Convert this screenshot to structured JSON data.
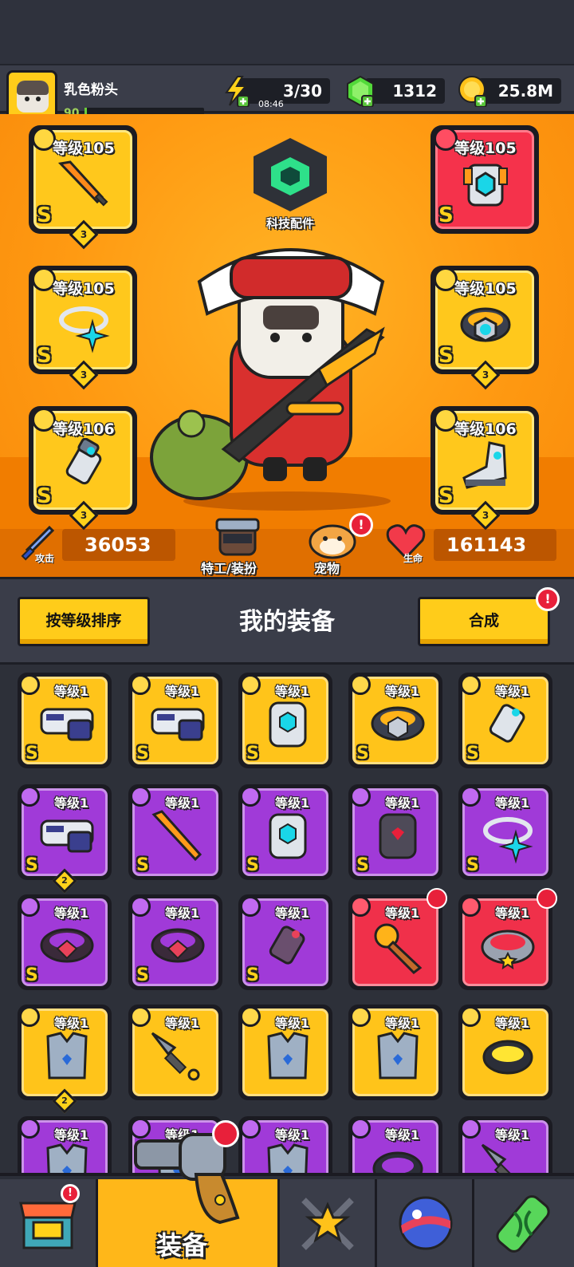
{
  "header": {
    "nickname": "乳色粉头",
    "level": "90",
    "energy": "3/30",
    "energy_timer": "08:46",
    "gems": "1312",
    "coins": "25.8M"
  },
  "hero": {
    "tech_label": "科技配件",
    "equipped": [
      {
        "slot": "weapon",
        "level": "等级105",
        "rank": "S",
        "stars": "3",
        "rarity": "yellow"
      },
      {
        "slot": "armor",
        "level": "等级105",
        "rank": "S",
        "stars": "",
        "rarity": "red"
      },
      {
        "slot": "necklace",
        "level": "等级105",
        "rank": "S",
        "stars": "3",
        "rarity": "yellow"
      },
      {
        "slot": "belt",
        "level": "等级105",
        "rank": "S",
        "stars": "3",
        "rarity": "yellow"
      },
      {
        "slot": "glove",
        "level": "等级106",
        "rank": "S",
        "stars": "3",
        "rarity": "yellow"
      },
      {
        "slot": "boots",
        "level": "等级106",
        "rank": "S",
        "stars": "3",
        "rarity": "yellow"
      }
    ],
    "attack_label": "攻击",
    "attack_value": "36053",
    "agent_label": "特工/装扮",
    "pet_label": "宠物",
    "hp_label": "生命",
    "hp_value": "161143"
  },
  "toolbar": {
    "sort_label": "按等级排序",
    "title": "我的装备",
    "merge_label": "合成"
  },
  "inventory": [
    {
      "level": "等级1",
      "rank": "S",
      "rarity": "yellow",
      "art": "gun",
      "count": ""
    },
    {
      "level": "等级1",
      "rank": "S",
      "rarity": "yellow",
      "art": "gun",
      "count": ""
    },
    {
      "level": "等级1",
      "rank": "S",
      "rarity": "yellow",
      "art": "armor",
      "count": ""
    },
    {
      "level": "等级1",
      "rank": "S",
      "rarity": "yellow",
      "art": "belt",
      "count": ""
    },
    {
      "level": "等级1",
      "rank": "S",
      "rarity": "yellow",
      "art": "glove",
      "count": ""
    },
    {
      "level": "等级1",
      "rank": "S",
      "rarity": "purple",
      "art": "gun",
      "count": "2"
    },
    {
      "level": "等级1",
      "rank": "S",
      "rarity": "purple",
      "art": "sword",
      "count": ""
    },
    {
      "level": "等级1",
      "rank": "S",
      "rarity": "purple",
      "art": "armor",
      "count": ""
    },
    {
      "level": "等级1",
      "rank": "S",
      "rarity": "purple",
      "art": "darkarmor",
      "count": ""
    },
    {
      "level": "等级1",
      "rank": "S",
      "rarity": "purple",
      "art": "necklace",
      "count": ""
    },
    {
      "level": "等级1",
      "rank": "S",
      "rarity": "purple",
      "art": "darkbelt",
      "count": ""
    },
    {
      "level": "等级1",
      "rank": "S",
      "rarity": "purple",
      "art": "darkbelt",
      "count": ""
    },
    {
      "level": "等级1",
      "rank": "S",
      "rarity": "purple",
      "art": "darkglove",
      "count": ""
    },
    {
      "level": "等级1",
      "rank": "",
      "rarity": "red",
      "art": "mic",
      "count": ""
    },
    {
      "level": "等级1",
      "rank": "",
      "rarity": "red",
      "art": "collar",
      "count": ""
    },
    {
      "level": "等级1",
      "rank": "",
      "rarity": "yellow",
      "art": "vest",
      "count": "2"
    },
    {
      "level": "等级1",
      "rank": "",
      "rarity": "yellow",
      "art": "kunai",
      "count": ""
    },
    {
      "level": "等级1",
      "rank": "",
      "rarity": "yellow",
      "art": "vest",
      "count": ""
    },
    {
      "level": "等级1",
      "rank": "",
      "rarity": "yellow",
      "art": "vest",
      "count": ""
    },
    {
      "level": "等级1",
      "rank": "",
      "rarity": "yellow",
      "art": "spikering",
      "count": ""
    },
    {
      "level": "等级1",
      "rank": "",
      "rarity": "purple",
      "art": "vest",
      "count": ""
    },
    {
      "level": "等级1",
      "rank": "",
      "rarity": "purple",
      "art": "vest",
      "count": ""
    },
    {
      "level": "等级1",
      "rank": "",
      "rarity": "purple",
      "art": "vest",
      "count": ""
    },
    {
      "level": "等级1",
      "rank": "",
      "rarity": "purple",
      "art": "ring",
      "count": ""
    },
    {
      "level": "等级1",
      "rank": "",
      "rarity": "purple",
      "art": "kunai",
      "count": ""
    }
  ],
  "nav": {
    "active_label": "装备",
    "tabs": [
      "shop-icon",
      "equipment-gun-icon",
      "crossed-swords-star-icon",
      "planet-ball-icon",
      "dna-capsule-icon"
    ]
  },
  "colors": {
    "yellow": "#ffc41a",
    "purple": "#a03ad8",
    "red": "#f0304a",
    "orange_bg": "#ff9a12"
  }
}
